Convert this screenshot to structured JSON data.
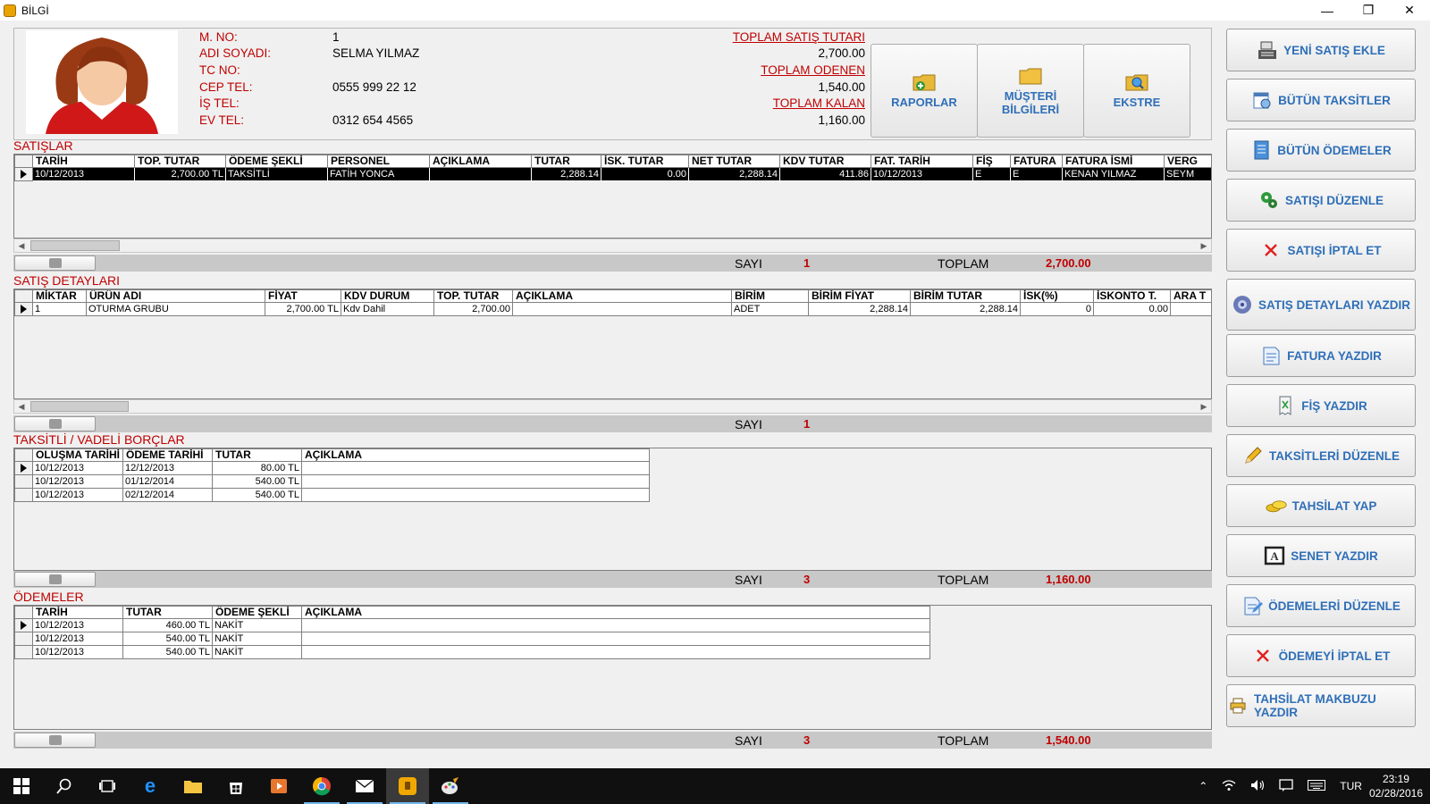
{
  "window": {
    "title": "BİLGİ",
    "minimize": "—",
    "maximize": "❐",
    "close": "✕"
  },
  "customer": {
    "labels": {
      "no": "M. NO:",
      "name": "ADI SOYADI:",
      "tc": "TC NO:",
      "cep": "CEP TEL:",
      "is": "İŞ TEL:",
      "ev": "EV TEL:"
    },
    "no": "1",
    "name": "SELMA YILMAZ",
    "tc": "",
    "cep": "0555 999 22 12",
    "is": "",
    "ev": "0312 654 4565"
  },
  "totals": {
    "sales_label": "TOPLAM SATIŞ TUTARI",
    "sales": "2,700.00",
    "paid_label": "TOPLAM ODENEN",
    "paid": "1,540.00",
    "remaining_label": "TOPLAM KALAN",
    "remaining": "1,160.00"
  },
  "top_buttons": {
    "reports": "RAPORLAR",
    "customer_info": "MÜŞTERİ BİLGİLERİ",
    "statement": "EKSTRE"
  },
  "sales": {
    "title": "SATIŞLAR",
    "columns": [
      "TARİH",
      "TOP. TUTAR",
      "ÖDEME ŞEKLİ",
      "PERSONEL",
      "AÇIKLAMA",
      "TUTAR",
      "İSK. TUTAR",
      "NET TUTAR",
      "KDV TUTAR",
      "FAT. TARİH",
      "FİŞ",
      "FATURA",
      "FATURA İSMİ",
      "VERG"
    ],
    "rows": [
      [
        "10/12/2013",
        "2,700.00 TL",
        "TAKSİTLİ",
        "FATİH YONCA",
        "",
        "2,288.14",
        "0.00",
        "2,288.14",
        "411.86",
        "10/12/2013",
        "E",
        "E",
        "KENAN YILMAZ",
        "SEYM"
      ]
    ],
    "count_label": "SAYI",
    "count": "1",
    "total_label": "TOPLAM",
    "total": "2,700.00"
  },
  "details": {
    "title": "SATIŞ DETAYLARI",
    "columns": [
      "MİKTAR",
      "ÜRÜN ADI",
      "FİYAT",
      "KDV DURUM",
      "TOP. TUTAR",
      "AÇIKLAMA",
      "BİRİM",
      "BİRİM FİYAT",
      "BİRİM TUTAR",
      "İSK(%)",
      "İSKONTO T.",
      "ARA T"
    ],
    "rows": [
      [
        "1",
        "OTURMA GRUBU",
        "2,700.00 TL",
        "Kdv Dahil",
        "2,700.00",
        "",
        "ADET",
        "2,288.14",
        "2,288.14",
        "0",
        "0.00",
        ""
      ]
    ],
    "count_label": "SAYI",
    "count": "1"
  },
  "installments": {
    "title": "TAKSİTLİ / VADELİ BORÇLAR",
    "columns": [
      "OLUŞMA TARİHİ",
      "ÖDEME TARİHİ",
      "TUTAR",
      "AÇIKLAMA"
    ],
    "rows": [
      [
        "10/12/2013",
        "12/12/2013",
        "80.00 TL",
        ""
      ],
      [
        "10/12/2013",
        "01/12/2014",
        "540.00 TL",
        ""
      ],
      [
        "10/12/2013",
        "02/12/2014",
        "540.00 TL",
        ""
      ]
    ],
    "count_label": "SAYI",
    "count": "3",
    "total_label": "TOPLAM",
    "total": "1,160.00"
  },
  "payments": {
    "title": "ÖDEMELER",
    "columns": [
      "TARİH",
      "TUTAR",
      "ÖDEME ŞEKLİ",
      "AÇIKLAMA"
    ],
    "rows": [
      [
        "10/12/2013",
        "460.00 TL",
        "NAKİT",
        ""
      ],
      [
        "10/12/2013",
        "540.00 TL",
        "NAKİT",
        ""
      ],
      [
        "10/12/2013",
        "540.00 TL",
        "NAKİT",
        ""
      ]
    ],
    "count_label": "SAYI",
    "count": "3",
    "total_label": "TOPLAM",
    "total": "1,540.00"
  },
  "side_buttons": [
    {
      "label": "YENİ SATIŞ EKLE",
      "icon": "cash-register-icon"
    },
    {
      "label": "BÜTÜN TAKSİTLER",
      "icon": "calendar-clock-icon"
    },
    {
      "label": "BÜTÜN ÖDEMELER",
      "icon": "notebook-icon"
    },
    {
      "label": "SATIŞI DÜZENLE",
      "icon": "gears-icon"
    },
    {
      "label": "SATIŞI İPTAL ET",
      "icon": "x-icon"
    },
    {
      "label": "SATIŞ DETAYLARI YAZDIR",
      "icon": "gear-print-icon"
    },
    {
      "label": "FATURA YAZDIR",
      "icon": "invoice-icon"
    },
    {
      "label": "FİŞ YAZDIR",
      "icon": "receipt-icon"
    },
    {
      "label": "TAKSİTLERİ DÜZENLE",
      "icon": "pencil-icon"
    },
    {
      "label": "TAHSİLAT YAP",
      "icon": "coins-icon"
    },
    {
      "label": "SENET YAZDIR",
      "icon": "document-frame-icon"
    },
    {
      "label": "ÖDEMELERİ DÜZENLE",
      "icon": "edit-document-icon"
    },
    {
      "label": "ÖDEMEYİ İPTAL ET",
      "icon": "x-icon"
    },
    {
      "label": "TAHSİLAT MAKBUZU YAZDIR",
      "icon": "printer-icon"
    }
  ],
  "taskbar": {
    "lang": "TUR",
    "time": "23:19",
    "date": "02/28/2016"
  },
  "colors": {
    "accent_red": "#c00000",
    "button_blue": "#2f6fb8"
  }
}
